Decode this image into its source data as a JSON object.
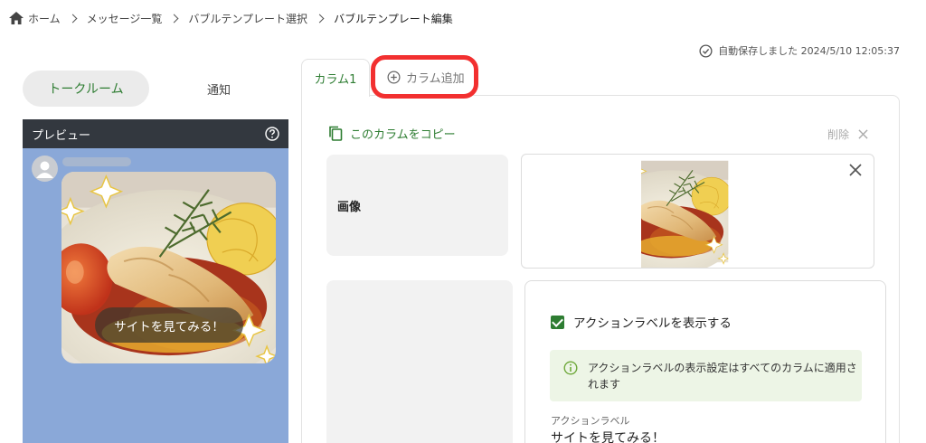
{
  "breadcrumb": {
    "items": [
      "ホーム",
      "メッセージ一覧",
      "バブルテンプレート選択",
      "バブルテンプレート編集"
    ]
  },
  "autosave": {
    "text": "自動保存しました 2024/5/10 12:05:37"
  },
  "view_toggle": {
    "active": "トークルーム",
    "inactive": "通知"
  },
  "preview": {
    "header": "プレビュー",
    "action_label": "サイトを見てみる！"
  },
  "tabs": {
    "column": "カラム1",
    "add": "カラム追加"
  },
  "editor": {
    "copy_label": "このカラムをコピー",
    "delete_label": "削除",
    "image_label": "画像",
    "checkbox_label": "アクションラベルを表示する",
    "info_text": "アクションラベルの表示設定はすべてのカラムに適用されます",
    "action_field_label": "アクションラベル",
    "action_field_value": "サイトを見てみる！"
  },
  "colors": {
    "accent_green": "#2e7d32",
    "highlight_red": "#f23030",
    "preview_bg": "#8aa8d8",
    "preview_header": "#33383f"
  },
  "icons": [
    "home-icon",
    "chevron-right-icon",
    "check-circle-icon",
    "help-icon",
    "user-icon",
    "plus-circle-icon",
    "copy-icon",
    "close-icon",
    "info-icon",
    "checkbox-icon"
  ]
}
